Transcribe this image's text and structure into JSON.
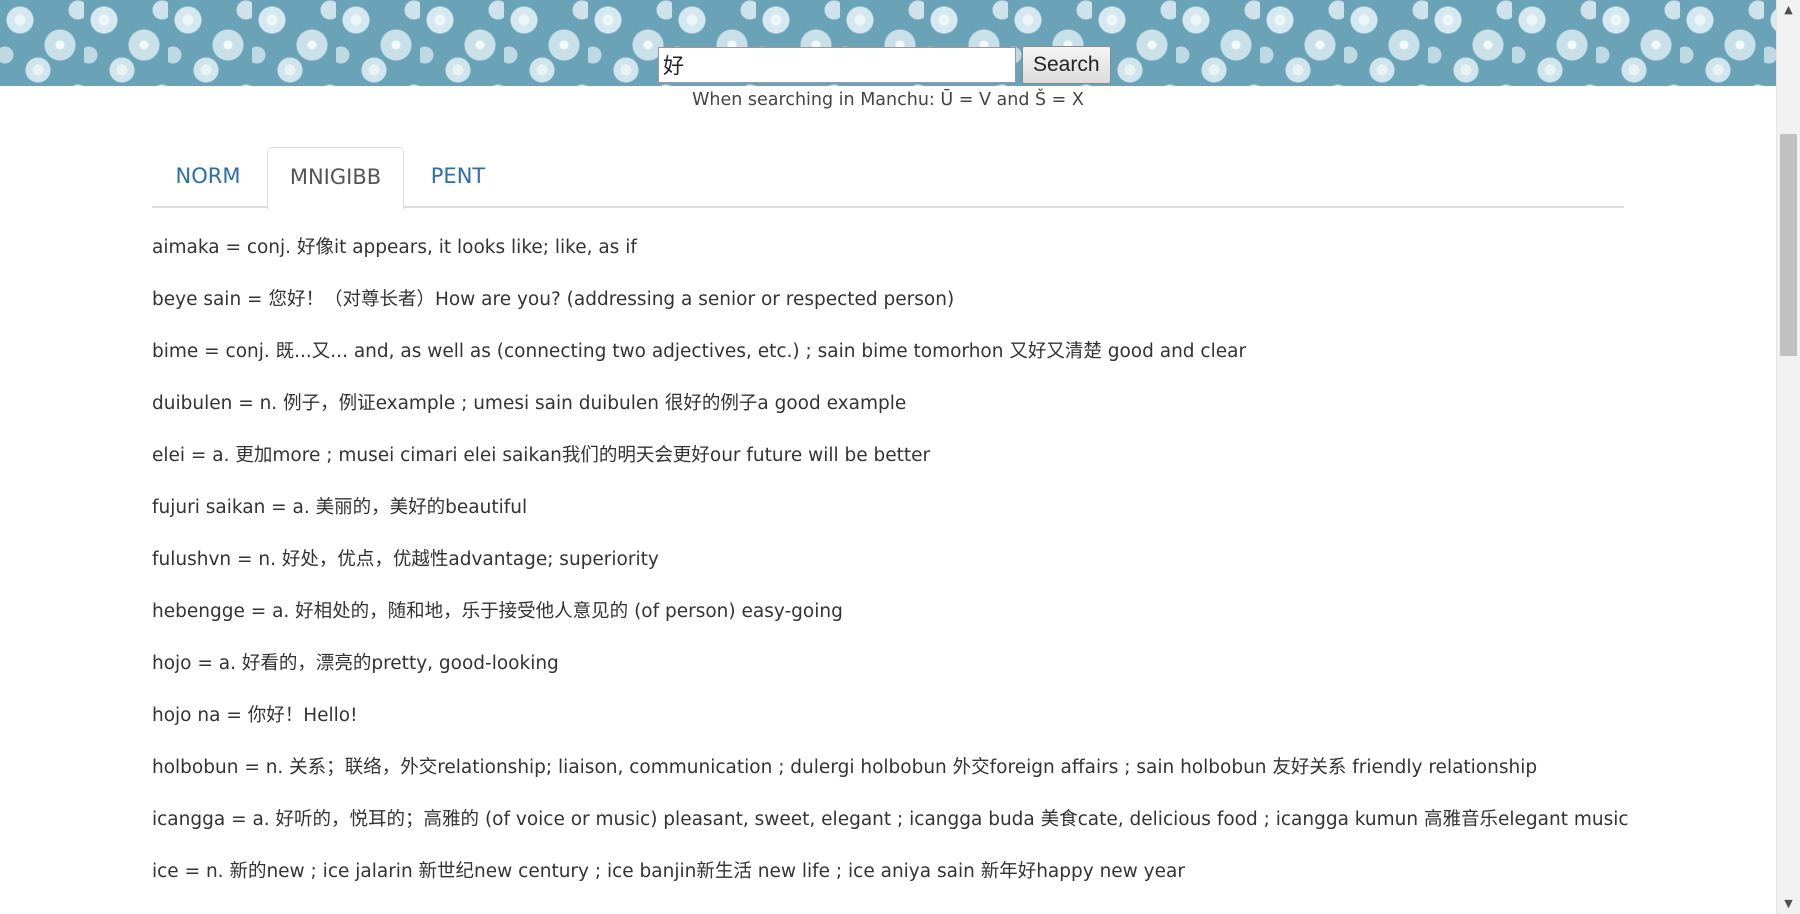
{
  "search": {
    "value": "好",
    "button_label": "Search",
    "hint": "When searching in Manchu: Ū = V and Š = X"
  },
  "tabs": [
    {
      "label": "NORM",
      "active": false
    },
    {
      "label": "MNIGIBB",
      "active": true
    },
    {
      "label": "PENT",
      "active": false
    }
  ],
  "entries": [
    "aimaka = conj. 好像it appears, it looks like; like, as if",
    "beye sain = 您好！（对尊长者）How are you? (addressing a senior or respected person)",
    "bime = conj. 既...又... and, as well as (connecting two adjectives, etc.) ; sain bime tomorhon 又好又清楚 good and clear",
    "duibulen = n. 例子，例证example ; umesi sain duibulen 很好的例子a good example",
    "elei = a. 更加more ; musei cimari elei saikan我们的明天会更好our future will be better",
    "fujuri saikan = a. 美丽的，美好的beautiful",
    "fulushvn = n. 好处，优点，优越性advantage; superiority",
    "hebengge = a. 好相处的，随和地，乐于接受他人意见的 (of person) easy-going",
    "hojo = a. 好看的，漂亮的pretty, good-looking",
    "hojo na = 你好！Hello!",
    "holbobun = n. 关系；联络，外交relationship; liaison, communication ; dulergi holbobun 外交foreign affairs ; sain holbobun 友好关系 friendly relationship",
    "icangga = a. 好听的，悦耳的；高雅的 (of voice or music) pleasant, sweet, elegant ; icangga buda 美食cate, delicious food ; icangga kumun 高雅音乐elegant music",
    "ice = n. 新的new ; ice jalarin 新世纪new century ; ice banjin新生活 new life ; ice aniya sain 新年好happy new year"
  ]
}
